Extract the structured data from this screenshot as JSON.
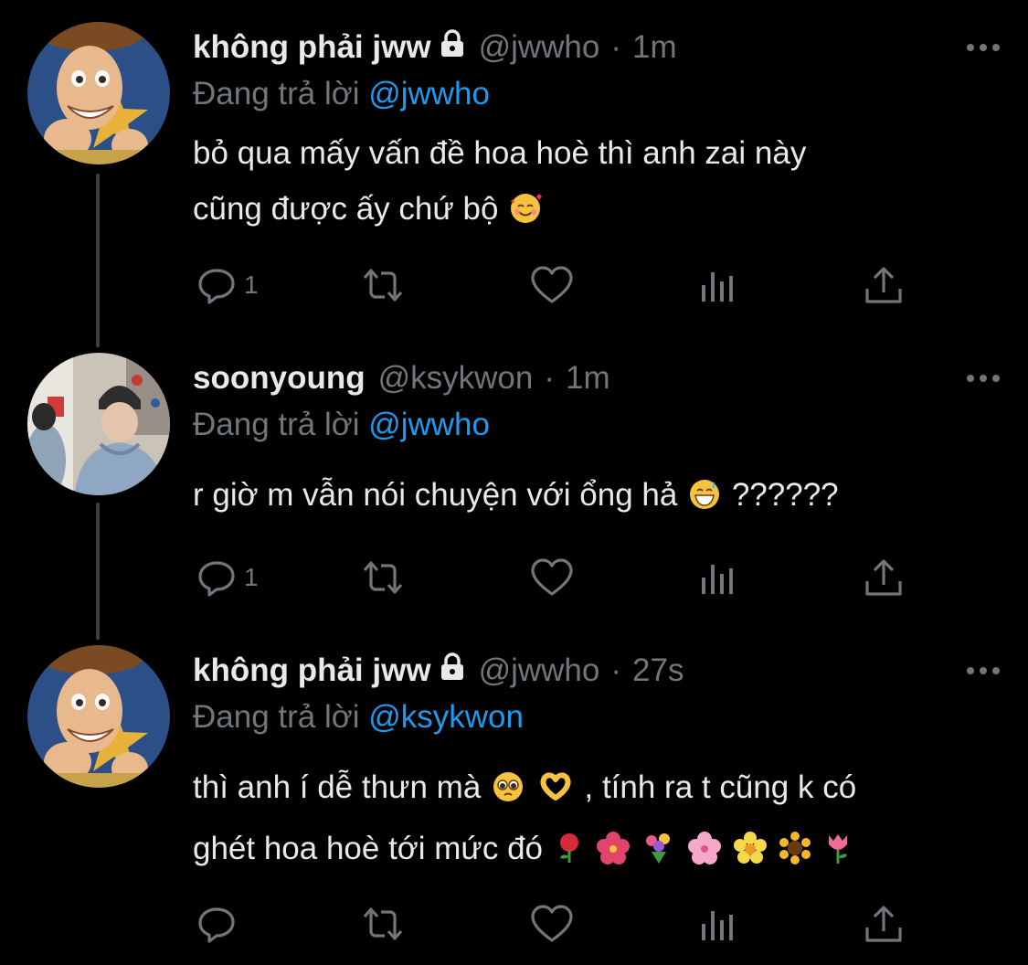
{
  "colors": {
    "background": "#000000",
    "text": "#e7e9ea",
    "secondary": "#71767b",
    "accent": "#1d9bf0"
  },
  "reply_prefix": "Đang trả lời",
  "tweets": [
    {
      "display_name": "không phải jww",
      "protected": true,
      "handle": "@jwwho",
      "separator": "·",
      "time": "1m",
      "reply_to": "@jwwho",
      "lines": [
        "bỏ qua mấy vấn đề hoa hoè thì anh zai này",
        "cũng được ấy chứ bộ"
      ],
      "emojis": [
        "smiling-face-with-hearts"
      ],
      "reply_count": "1",
      "avatar": "cowboy-toy-avatar"
    },
    {
      "display_name": "soonyoung",
      "protected": false,
      "handle": "@ksykwon",
      "separator": "·",
      "time": "1m",
      "reply_to": "@jwwho",
      "lines": [
        "r giờ m vẫn nói chuyện với ổng hả",
        "??????"
      ],
      "emojis": [
        "grinning-sweat"
      ],
      "reply_count": "1",
      "avatar": "person-beanie-photo-avatar"
    },
    {
      "display_name": "không phải jww",
      "protected": true,
      "handle": "@jwwho",
      "separator": "·",
      "time": "27s",
      "reply_to": "@ksykwon",
      "lines": [
        "thì anh í dễ thưn mà",
        ", tính ra t cũng k có",
        "ghét hoa hoè tới mức đó"
      ],
      "emojis": [
        "pleading-face",
        "heart-hands",
        "rose",
        "hibiscus",
        "bouquet",
        "cherry-blossom",
        "blossom",
        "sunflower",
        "tulip"
      ],
      "reply_count": "",
      "avatar": "cowboy-toy-avatar"
    }
  ],
  "icons": [
    "reply-icon",
    "retweet-icon",
    "like-icon",
    "views-icon",
    "share-icon",
    "more-icon",
    "lock-icon"
  ]
}
